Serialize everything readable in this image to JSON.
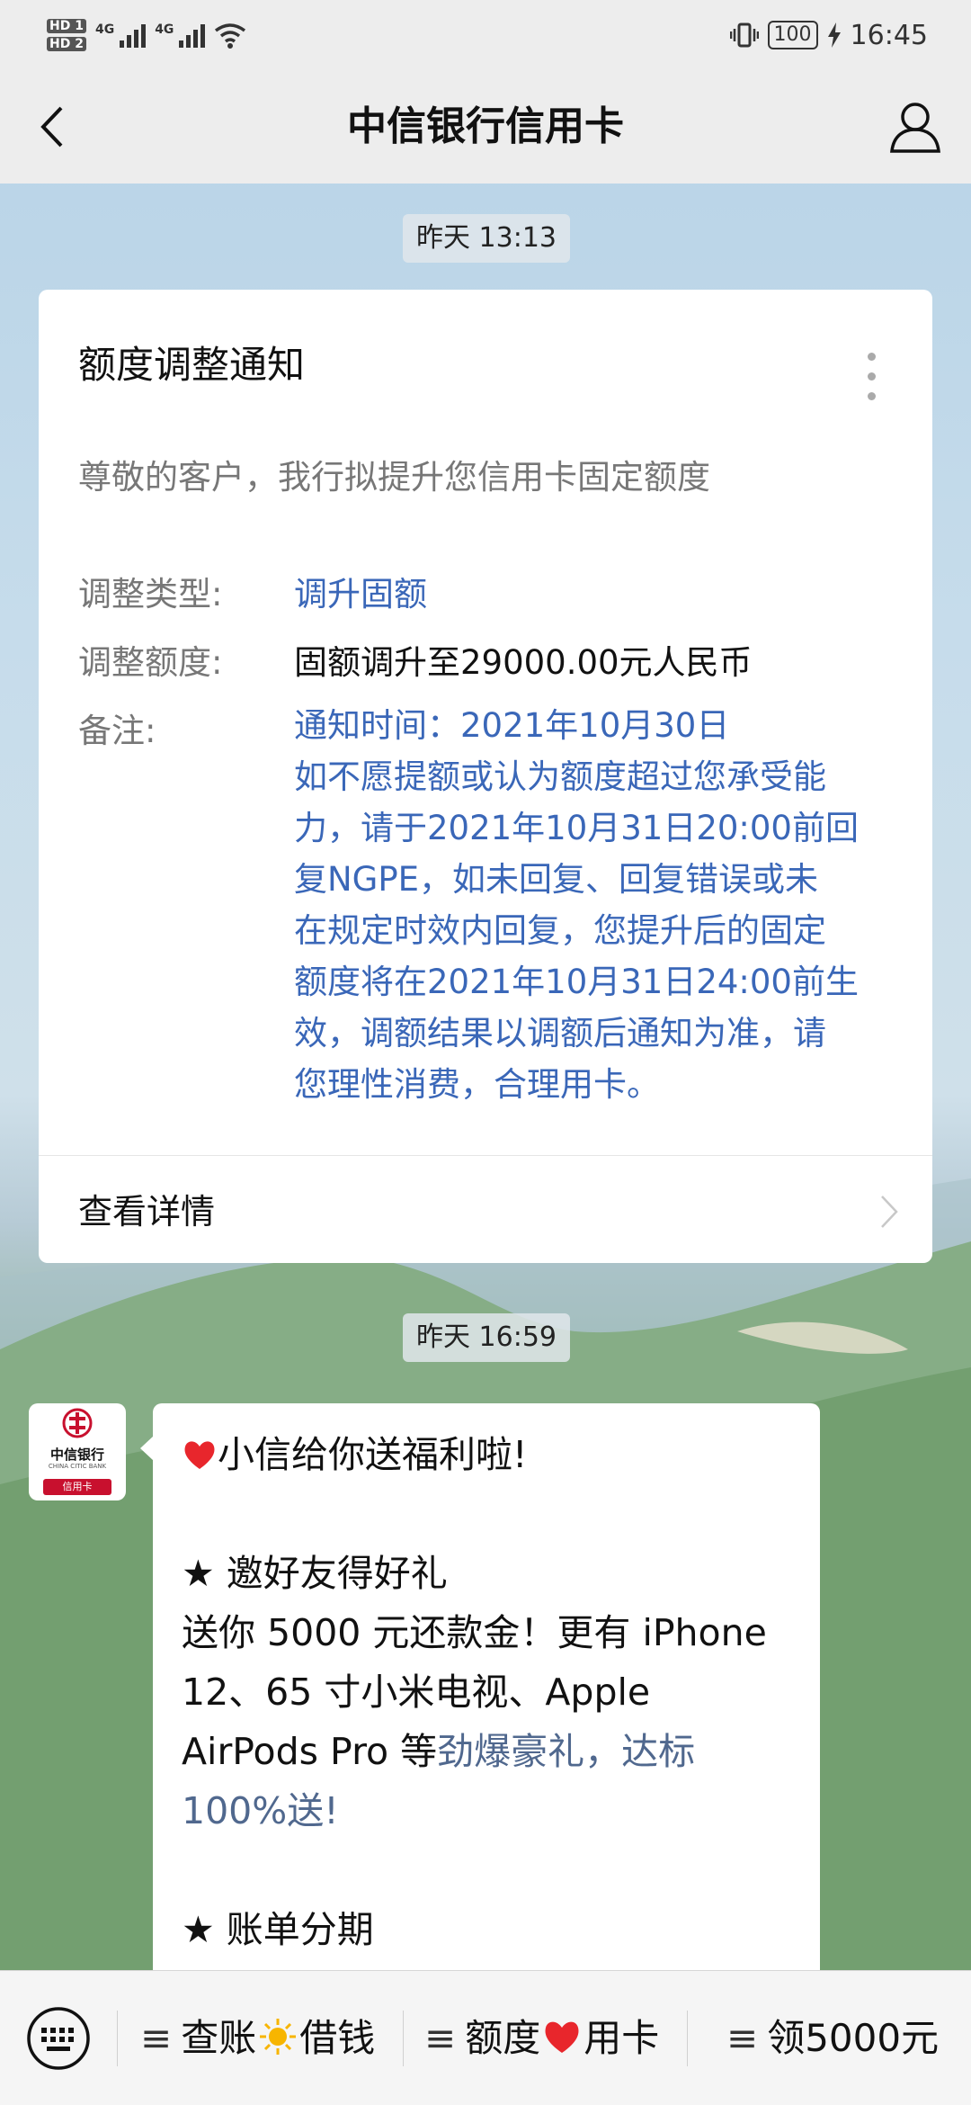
{
  "status_bar": {
    "left_badges": [
      "HD 1",
      "HD 2"
    ],
    "network_labels": [
      "4G",
      "4G"
    ],
    "battery": "100",
    "time": "16:45"
  },
  "header": {
    "title": "中信银行信用卡",
    "back_icon": "chevron-left-icon",
    "profile_icon": "user-icon"
  },
  "messages": {
    "timestamp_1": "昨天 13:13",
    "notice": {
      "title": "额度调整通知",
      "intro": "尊敬的客户，我行拟提升您信用卡固定额度",
      "rows": [
        {
          "label": "调整类型:",
          "value": "调升固额"
        },
        {
          "label": "调整额度:",
          "value": "固额调升至29000.00元人民币"
        },
        {
          "label": "备注:"
        }
      ],
      "remark_lines": [
        "通知时间：2021年10月30日",
        "如不愿提额或认为额度超过您承受能",
        "力，请于2021年10月31日20:00前回",
        "复NGPE，如未回复、回复错误或未",
        "在规定时效内回复，您提升后的固定",
        "额度将在2021年10月31日24:00前生",
        "效，调额结果以调额后通知为准，请",
        "您理性消费，合理用卡。"
      ],
      "detail_link": "查看详情"
    },
    "timestamp_2": "昨天 16:59",
    "promo": {
      "avatar": {
        "logo_name": "中信银行",
        "logo_en": "CHINA CITIC BANK",
        "logo_badge": "信用卡"
      },
      "heading": "小信给你送福利啦!",
      "section1_title": "★ 邀好友得好礼",
      "section1_line1": "送你 5000 元还款金！更有 iPhone",
      "section1_line2": "12、65 寸小米电视、Apple",
      "section1_line3_plain": "AirPods Pro 等",
      "section1_line3_link": "劲爆豪礼，达标",
      "section1_line4_link": "100%送!",
      "section2_title": "★ 账单分期"
    }
  },
  "bottom_menu": {
    "keyboard_icon": "keyboard-icon",
    "items": [
      {
        "prefix": "≡",
        "left": "查账",
        "emoji": "sun-icon",
        "right": "借钱"
      },
      {
        "prefix": "≡",
        "left": "额度",
        "emoji": "heart-icon",
        "right": "用卡"
      },
      {
        "prefix": "≡",
        "left": "领5000元"
      }
    ]
  },
  "colors": {
    "link_blue": "#3a67b8",
    "muted_gray": "#777777",
    "brand_red": "#c8102e",
    "heart_red": "#e8262c",
    "sun_yellow": "#f7b500"
  }
}
